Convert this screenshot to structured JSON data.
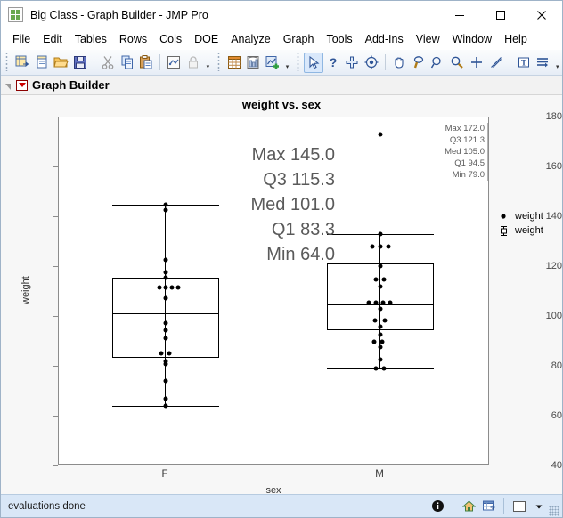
{
  "window": {
    "title": "Big Class - Graph Builder - JMP Pro",
    "app_icon": "jmp-icon",
    "minimize": "minimize-button",
    "maximize": "maximize-button",
    "close": "close-button"
  },
  "menubar": {
    "items": [
      {
        "label": "File"
      },
      {
        "label": "Edit"
      },
      {
        "label": "Tables"
      },
      {
        "label": "Rows"
      },
      {
        "label": "Cols"
      },
      {
        "label": "DOE"
      },
      {
        "label": "Analyze"
      },
      {
        "label": "Graph"
      },
      {
        "label": "Tools"
      },
      {
        "label": "Add-Ins"
      },
      {
        "label": "View"
      },
      {
        "label": "Window"
      },
      {
        "label": "Help"
      }
    ]
  },
  "toolbar": {
    "groups": [
      {
        "icons": [
          "new-data-table-icon",
          "new-script-icon",
          "open-file-icon",
          "save-icon"
        ]
      },
      {
        "icons": [
          "cut-icon",
          "copy-icon",
          "paste-icon"
        ]
      },
      {
        "icons": [
          "journal-icon",
          "lock-icon"
        ]
      },
      {
        "icons": [
          "data-table-icon",
          "report-icon",
          "add-graph-icon"
        ]
      },
      {
        "icons": [
          "arrow-select-icon",
          "help-question-icon",
          "crosshair-icon",
          "brush-target-icon"
        ]
      },
      {
        "icons": [
          "hand-pan-icon",
          "lasso-icon",
          "magnifier-small-icon",
          "magnifier-zoom-icon",
          "crosshairs-plus-icon",
          "line-draw-icon"
        ]
      },
      {
        "icons": [
          "text-annotate-icon",
          "simple-shape-icon"
        ]
      }
    ]
  },
  "outline": {
    "disclosure": "disclosure-triangle",
    "red_triangle": "red-triangle-menu",
    "title": "Graph Builder"
  },
  "chart_data": {
    "type": "box",
    "title": "weight vs. sex",
    "xlabel": "sex",
    "ylabel": "weight",
    "categories": [
      "F",
      "M"
    ],
    "ylim": [
      40,
      180
    ],
    "yticks": [
      180,
      160,
      140,
      120,
      100,
      80,
      60,
      40
    ],
    "ytick_labels": [
      "180",
      "160",
      "140",
      "120",
      "100",
      "80",
      "60",
      "40"
    ],
    "grid": false,
    "legend": {
      "position": "right",
      "entries": [
        {
          "marker": "point-marker-icon",
          "label": "weight"
        },
        {
          "marker": "boxplot-marker-icon",
          "label": "weight"
        }
      ]
    },
    "groups": [
      {
        "name": "F",
        "stats": {
          "Max": "145.0",
          "Q3": "115.3",
          "Med": "101.0",
          "Q1": "83.3",
          "Min": "64.0"
        },
        "stats_max": 145.0,
        "stats_q3": 115.3,
        "stats_med": 101.0,
        "stats_q1": 83.3,
        "stats_min": 64.0,
        "points": [
          145,
          143,
          123,
          118,
          116,
          112,
          112,
          112,
          112,
          108,
          98,
          95,
          92,
          90,
          90,
          85,
          84,
          74,
          67,
          64
        ]
      },
      {
        "name": "M",
        "stats": {
          "Max": "172.0",
          "Q3": "121.3",
          "Med": "105.0",
          "Q1": "94.5",
          "Min": "79.0"
        },
        "stats_max": 172.0,
        "stats_q3": 121.3,
        "stats_med": 105.0,
        "stats_q1": 94.5,
        "stats_min": 79.0,
        "points": [
          172,
          133,
          128,
          128,
          128,
          120,
          115,
          115,
          112,
          105,
          105,
          105,
          105,
          104,
          99,
          99,
          97,
          95,
          92,
          92,
          90,
          85,
          80,
          79,
          79
        ]
      }
    ],
    "annotation_f_lines": [
      "Max 145.0",
      "Q3  115.3",
      "Med 101.0",
      "Q1  83.3",
      "Min 64.0"
    ],
    "annotation_m_lines": [
      "Max 172.0",
      "Q3  121.3",
      "Med 105.0",
      "Q1  94.5",
      "Min 79.0"
    ]
  },
  "statusbar": {
    "message": "evaluations done",
    "icons": [
      "info-icon",
      "home-icon",
      "data-table-small-icon",
      "white-square-icon",
      "dropdown-arrow-icon"
    ],
    "resize_grip": "resize-grip"
  }
}
